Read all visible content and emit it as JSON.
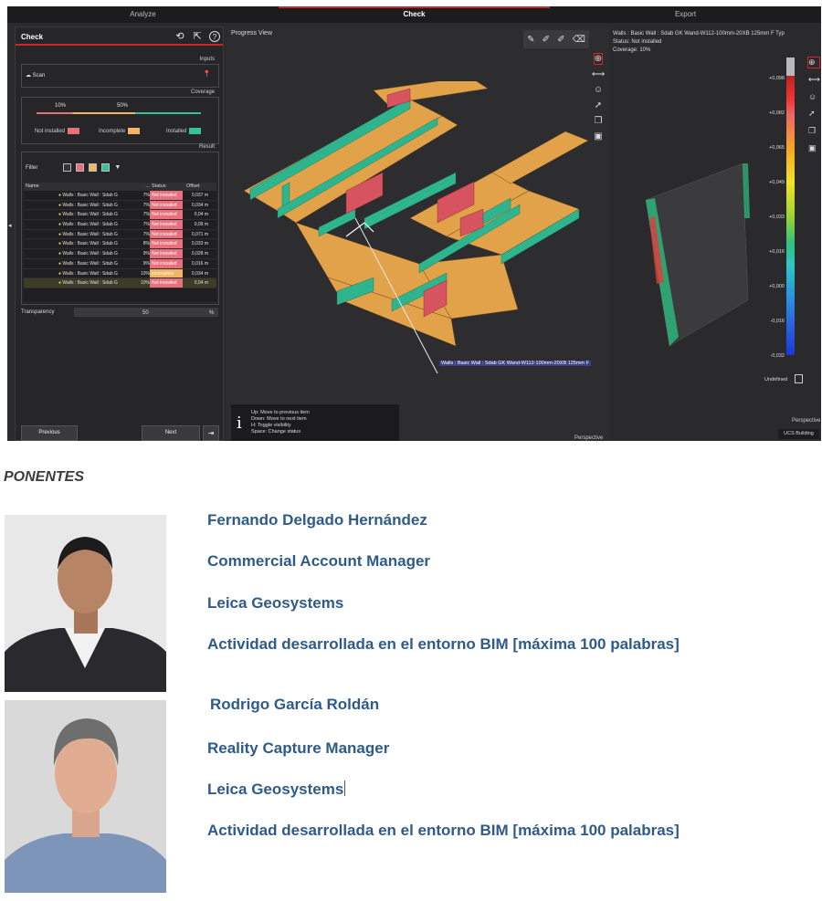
{
  "app": {
    "top_tabs": [
      "Analyze",
      "Check",
      "Export"
    ],
    "active_tab": "Check"
  },
  "left_panel": {
    "title": "Check",
    "inputs_label": "Inputs",
    "scan_label": "Scan",
    "coverage_label": "Coverage",
    "coverage_marks": [
      "10%",
      "50%"
    ],
    "legend": [
      {
        "label": "Not installed",
        "color": "#e7707c"
      },
      {
        "label": "Incomplete",
        "color": "#f2b566"
      },
      {
        "label": "Installed",
        "color": "#35c29a"
      }
    ],
    "result_label": "Result",
    "filter_label": "Filter",
    "table": {
      "headers": [
        "Name",
        "...",
        "Status",
        "Offset"
      ],
      "rows": [
        {
          "name": "Walls : Basic Wall : Sdab G",
          "pct": "7%",
          "status": "Not installed",
          "offset": "0,037 m"
        },
        {
          "name": "Walls : Basic Wall : Sdab G",
          "pct": "7%",
          "status": "Not installed",
          "offset": "0,034 m"
        },
        {
          "name": "Walls : Basic Wall : Sdab G",
          "pct": "7%",
          "status": "Not installed",
          "offset": "0,04 m"
        },
        {
          "name": "Walls : Basic Wall : Sdab G",
          "pct": "7%",
          "status": "Not installed",
          "offset": "0,09 m"
        },
        {
          "name": "Walls : Basic Wall : Sdab G",
          "pct": "7%",
          "status": "Not installed",
          "offset": "0,071 m"
        },
        {
          "name": "Walls : Basic Wall : Sdab G",
          "pct": "8%",
          "status": "Not installed",
          "offset": "0,033 m"
        },
        {
          "name": "Walls : Basic Wall : Sdab G",
          "pct": "9%",
          "status": "Not installed",
          "offset": "0,028 m"
        },
        {
          "name": "Walls : Basic Wall : Sdab G",
          "pct": "9%",
          "status": "Not installed",
          "offset": "0,016 m"
        },
        {
          "name": "Walls : Basic Wall : Sdab G",
          "pct": "10%",
          "status": "Incomplete",
          "offset": "0,034 m"
        },
        {
          "name": "Walls : Basic Wall : Sdab G",
          "pct": "10%",
          "status": "Not installed",
          "offset": "0,04 m"
        }
      ]
    },
    "transparency_label": "Transparency",
    "transparency_value": "50",
    "transparency_unit": "%",
    "prev_button": "Previous",
    "next_button": "Next"
  },
  "center_view": {
    "title": "Progress View",
    "wall_label": "Walls : Basic Wall : Sdab GK Wand-W112-100mm-20XB 125mm F",
    "info_lines": [
      "Up: Move to previous item",
      "Down: Move to next item",
      "H: Toggle visibility",
      "Space: Change status"
    ],
    "perspective_label": "Perspective"
  },
  "right_panel": {
    "info_lines": [
      "Walls : Basic Wall : Sdab GK Wand-W112-100mm-20XB 125mm F Typ",
      "Status: Not installed",
      "Coverage: 10%"
    ],
    "scale_ticks": [
      "+0,098",
      "+0,082",
      "+0,065",
      "+0,049",
      "+0,033",
      "+0,016",
      "+0,000",
      "-0,016",
      "-0,032"
    ],
    "undefined_label": "Undefined",
    "perspective_label": "Perspective",
    "ucs_button": "UCS Building"
  },
  "section_title": "PONENTES",
  "speakers": [
    {
      "name": "Fernando Delgado Hernández",
      "role": "Commercial Account Manager",
      "company": "Leica Geosystems",
      "activity": "Actividad desarrollada en el entorno BIM [máxima 100 palabras]"
    },
    {
      "name": "Rodrigo García Roldán",
      "role": "Reality Capture Manager",
      "company": "Leica Geosystems",
      "activity": "Actividad desarrollada en el entorno BIM [máxima 100 palabras]"
    }
  ]
}
